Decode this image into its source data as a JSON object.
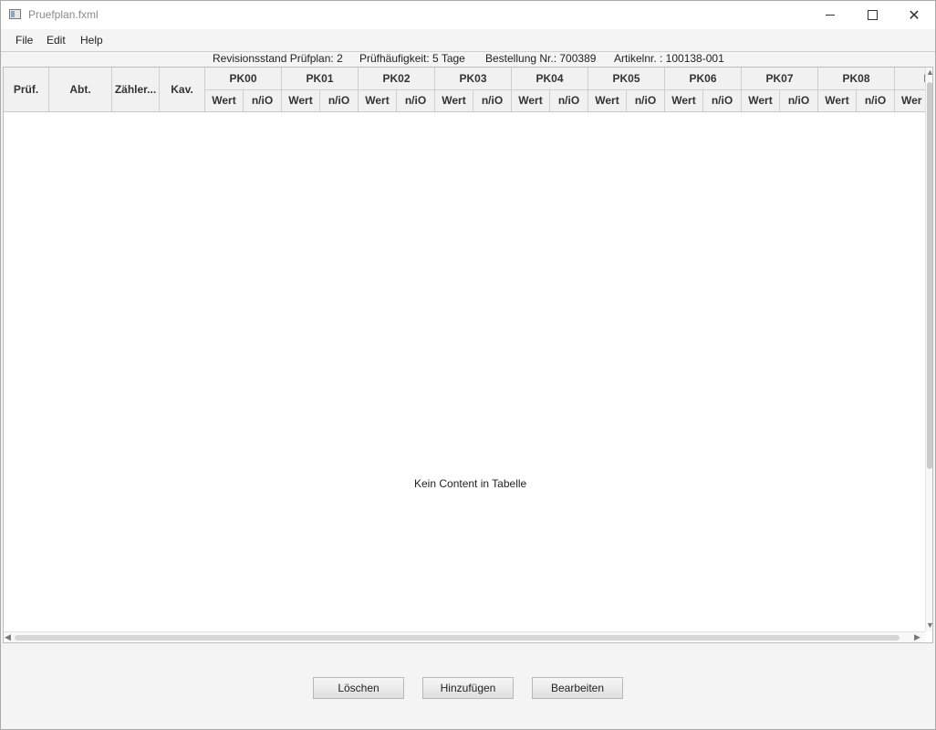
{
  "window": {
    "title": "Pruefplan.fxml"
  },
  "menu": {
    "file": "File",
    "edit": "Edit",
    "help": "Help"
  },
  "info": {
    "revision": "Revisionsstand Prüfplan:  2",
    "frequency": "Prüfhäufigkeit:  5 Tage",
    "order": "Bestellung Nr.:  700389",
    "article": "Artikelnr. :  100138-001"
  },
  "table": {
    "columns": [
      "Prüf.",
      "Abt.",
      "Zähler...",
      "Kav."
    ],
    "groups": [
      "PK00",
      "PK01",
      "PK02",
      "PK03",
      "PK04",
      "PK05",
      "PK06",
      "PK07",
      "PK08"
    ],
    "sub_value": "Wert",
    "sub_nio": "n/iO",
    "cut_group_label": "I",
    "cut_sub_label": "Wer",
    "placeholder": "Kein Content in Tabelle"
  },
  "buttons": {
    "delete": "Löschen",
    "add": "Hinzufügen",
    "edit": "Bearbeiten"
  }
}
